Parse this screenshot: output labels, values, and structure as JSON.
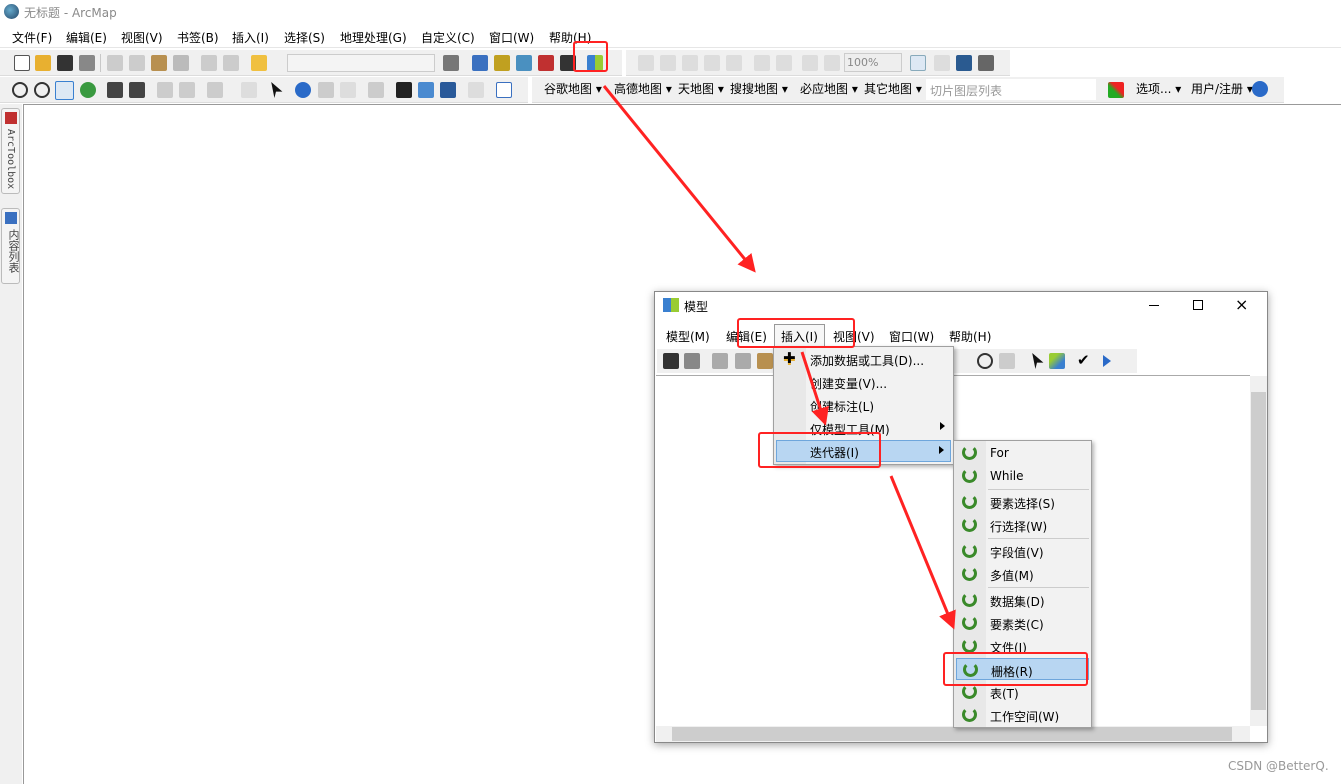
{
  "app": {
    "title": "无标题 - ArcMap"
  },
  "menubar": [
    "文件(F)",
    "编辑(E)",
    "视图(V)",
    "书签(B)",
    "插入(I)",
    "选择(S)",
    "地理处理(G)",
    "自定义(C)",
    "窗口(W)",
    "帮助(H)"
  ],
  "toolbar": {
    "scale_value": "",
    "zoom_value": "100%",
    "tile_layer_placeholder": "切片图层列表",
    "map_dropdowns": [
      "谷歌地图",
      "高德地图",
      "天地图",
      "搜搜地图",
      "必应地图",
      "其它地图"
    ],
    "options_label": "选项...",
    "register_label": "用户/注册"
  },
  "sidebar": {
    "tabs": [
      "ArcToolbox",
      "内容列表"
    ]
  },
  "model_window": {
    "title": "模型",
    "menubar": [
      "模型(M)",
      "编辑(E)",
      "插入(I)",
      "视图(V)",
      "窗口(W)",
      "帮助(H)"
    ],
    "insert_menu": [
      "添加数据或工具(D)...",
      "创建变量(V)...",
      "创建标注(L)",
      "仅模型工具(M)",
      "迭代器(I)"
    ],
    "iterator_menu": [
      "For",
      "While",
      "要素选择(S)",
      "行选择(W)",
      "字段值(V)",
      "多值(M)",
      "数据集(D)",
      "要素类(C)",
      "文件(I)",
      "栅格(R)",
      "表(T)",
      "工作空间(W)"
    ]
  },
  "watermark": "CSDN @BetterQ.",
  "colors": {
    "highlight": "#b8d6f2",
    "annotation": "#ff2222",
    "iterator_icon": "#3a8a2a"
  }
}
